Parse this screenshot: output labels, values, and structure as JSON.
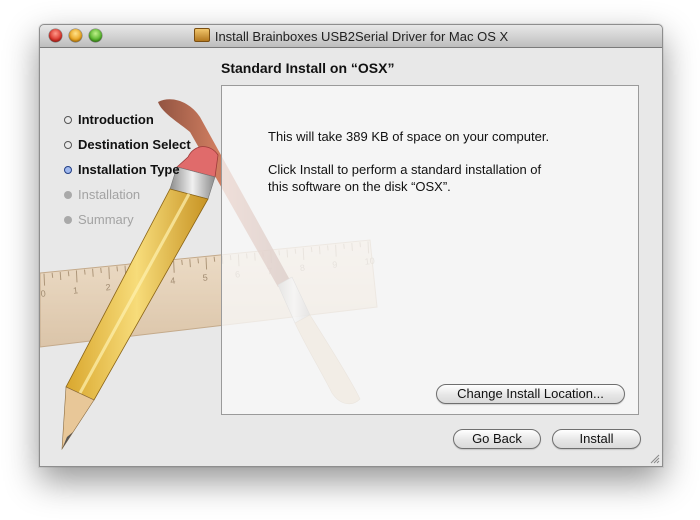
{
  "window": {
    "title": "Install Brainboxes USB2Serial Driver for Mac OS X",
    "title_icon": "package-icon"
  },
  "heading": "Standard Install on “OSX”",
  "steps": [
    {
      "label": "Introduction",
      "state": "done"
    },
    {
      "label": "Destination Select",
      "state": "done"
    },
    {
      "label": "Installation Type",
      "state": "current"
    },
    {
      "label": "Installation",
      "state": "pending"
    },
    {
      "label": "Summary",
      "state": "pending"
    }
  ],
  "content": {
    "space_text": "This will take 389 KB of space on your computer.",
    "install_text_line1": "Click Install to perform a standard installation of",
    "install_text_line2": "this software on the disk “OSX”."
  },
  "buttons": {
    "change_location": "Change Install Location...",
    "go_back": "Go Back",
    "install": "Install"
  },
  "ruler": {
    "ticks": [
      "0",
      "1",
      "2",
      "3",
      "4",
      "5",
      "6",
      "7",
      "8",
      "9",
      "10"
    ]
  },
  "colors": {
    "close": "#d8332a",
    "minimize": "#e8a31f",
    "zoom": "#54b22a",
    "current_step_dot": "#9fb8ee"
  }
}
